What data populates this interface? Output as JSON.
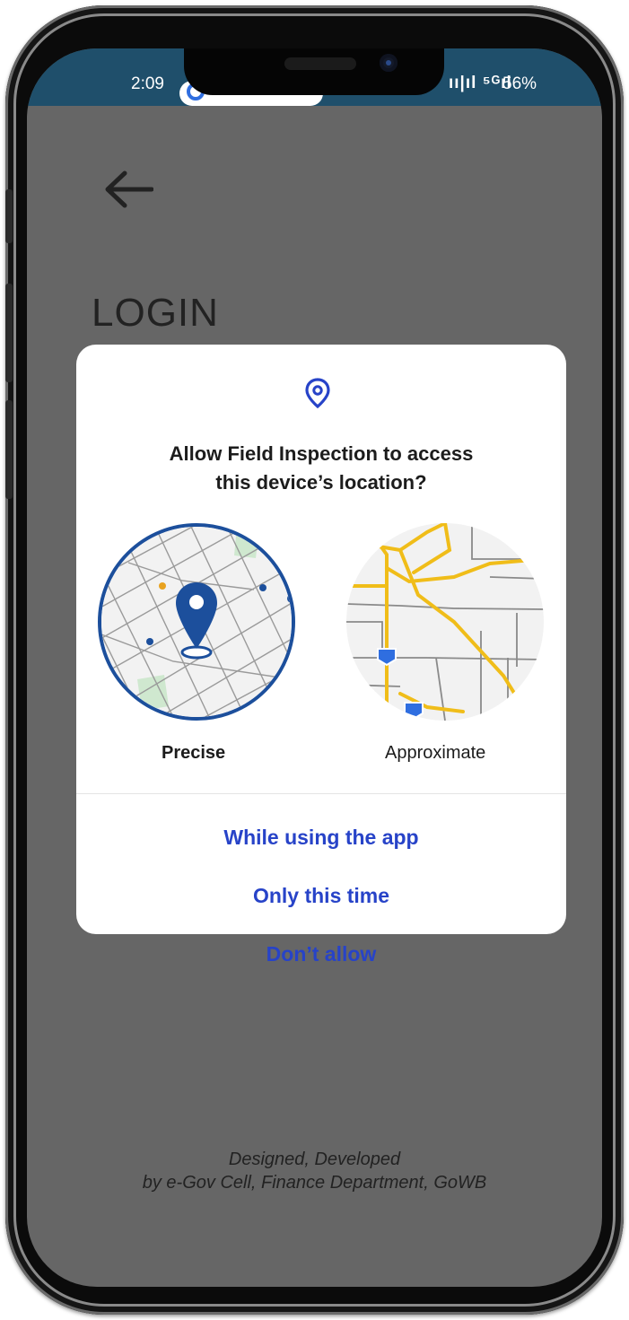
{
  "status_bar": {
    "time": "2:09",
    "signal": "ıı|ıl ⁵ᴳıl",
    "battery": "56%"
  },
  "page": {
    "title": "LOGIN",
    "footer_line1": "Designed, Developed",
    "footer_line2": "by e-Gov Cell, Finance Department, GoWB"
  },
  "dialog": {
    "title_line1": "Allow Field Inspection to access",
    "title_line2": "this device’s location?",
    "options": {
      "precise": "Precise",
      "approximate": "Approximate"
    },
    "actions": {
      "while_using": "While using the app",
      "only_this_time": "Only this time",
      "dont_allow": "Don’t allow"
    }
  },
  "colors": {
    "accent": "#2743c8",
    "map_pin": "#1c4f9c",
    "status_bar": "#1f4f6b",
    "scrim": "#666666"
  },
  "icons": [
    "back-arrow-icon",
    "location-pin-icon",
    "map-pin-icon"
  ]
}
